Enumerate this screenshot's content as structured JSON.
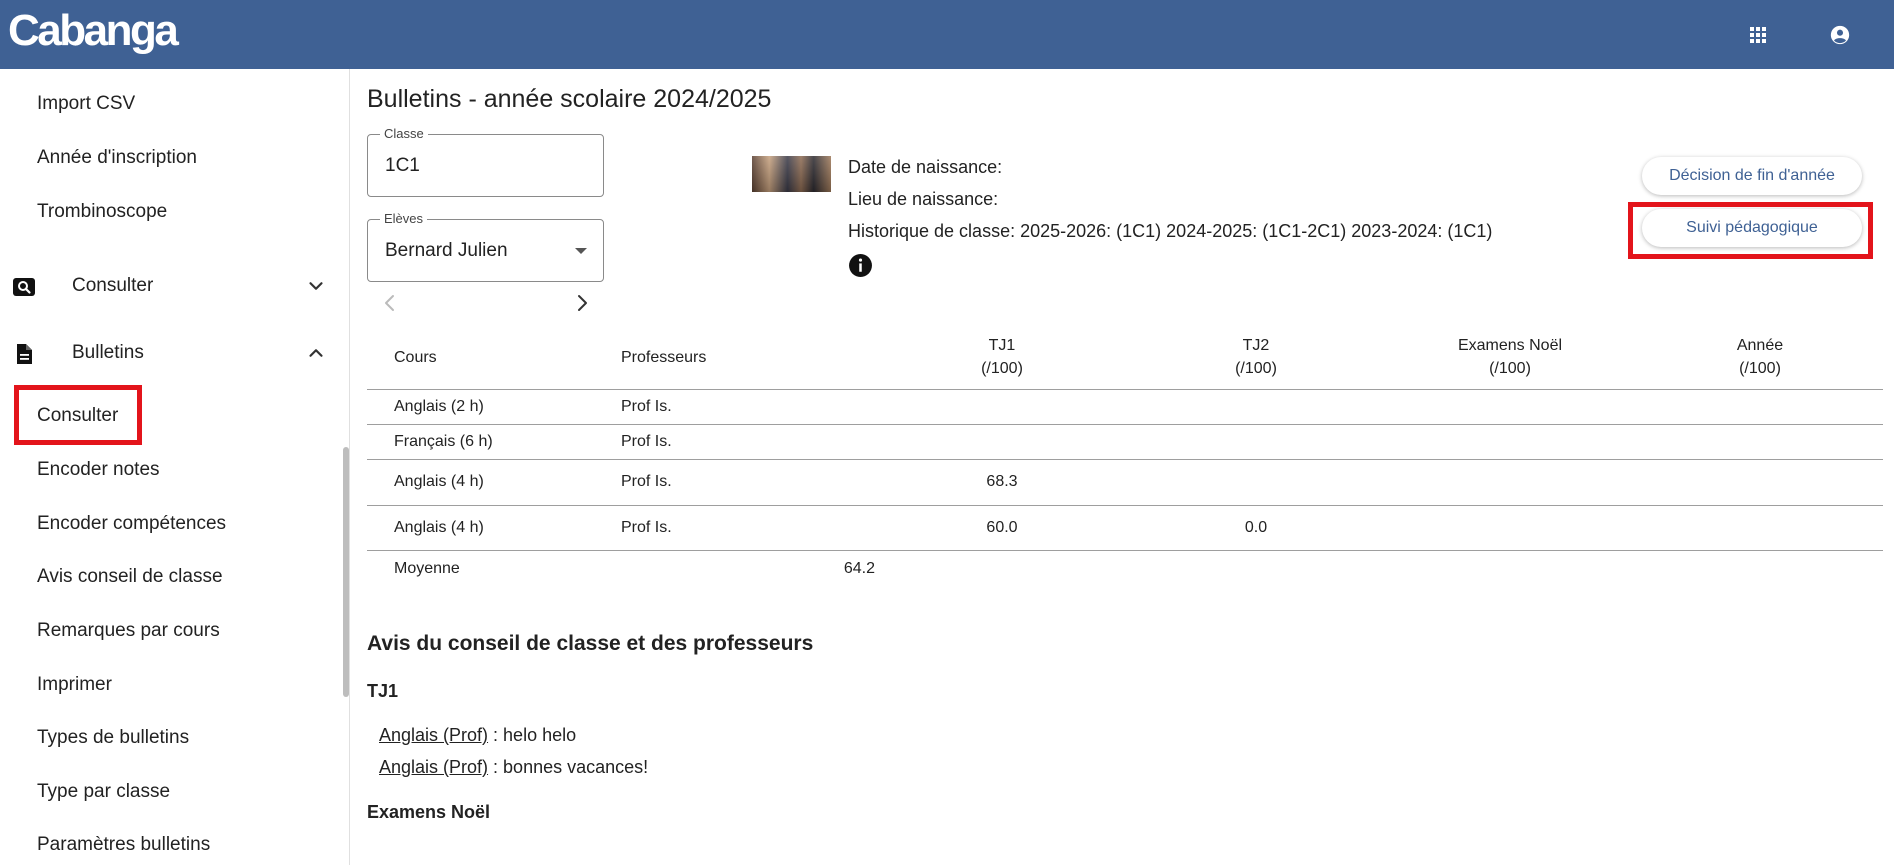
{
  "app": {
    "logo": "Cabanga",
    "apps_icon": "apps-grid-icon",
    "account_icon": "account-circle-icon",
    "header_color": "#3f6194"
  },
  "sidebar": {
    "items_top": [
      {
        "label": "Import CSV"
      },
      {
        "label": "Année d'inscription"
      },
      {
        "label": "Trombinoscope"
      }
    ],
    "groups": [
      {
        "label": "Consulter",
        "icon": "search-icon",
        "state": "collapsed"
      },
      {
        "label": "Bulletins",
        "icon": "document-icon",
        "state": "expanded"
      }
    ],
    "bulletins_items": [
      {
        "label": "Consulter",
        "selected": true
      },
      {
        "label": "Encoder notes"
      },
      {
        "label": "Encoder compétences"
      },
      {
        "label": "Avis conseil de classe"
      },
      {
        "label": "Remarques par cours"
      },
      {
        "label": "Imprimer"
      },
      {
        "label": "Types de bulletins"
      },
      {
        "label": "Type par classe"
      },
      {
        "label": "Paramètres bulletins"
      }
    ]
  },
  "main": {
    "title": "Bulletins - année scolaire 2024/2025",
    "classe": {
      "label": "Classe",
      "value": "1C1"
    },
    "eleves": {
      "label": "Elèves",
      "value": "Bernard Julien"
    },
    "student": {
      "dob": "Date de naissance:",
      "pob": "Lieu de naissance:",
      "history": "Historique de classe: 2025-2026: (1C1) 2024-2025: (1C1-2C1) 2023-2024: (1C1)"
    },
    "buttons": {
      "decision": "Décision de fin d'année",
      "suivi": "Suivi pédagogique"
    },
    "table": {
      "headers": {
        "cours": "Cours",
        "professeurs": "Professeurs",
        "tj1": "TJ1",
        "tj1_unit": "(/100)",
        "tj2": "TJ2",
        "tj2_unit": "(/100)",
        "examens": "Examens Noël",
        "examens_unit": "(/100)",
        "annee": "Année",
        "annee_unit": "(/100)"
      },
      "rows": [
        {
          "cours": "Anglais (2 h)",
          "prof": "Prof Is.",
          "tj1": "",
          "tj2": ""
        },
        {
          "cours": "Français (6 h)",
          "prof": "Prof Is.",
          "tj1": "",
          "tj2": ""
        },
        {
          "cours": "Anglais (4 h)",
          "prof": "Prof Is.",
          "tj1": "68.3",
          "tj2": ""
        },
        {
          "cours": "Anglais (4 h)",
          "prof": "Prof Is.",
          "tj1": "60.0",
          "tj2": "0.0"
        }
      ],
      "average": {
        "label": "Moyenne",
        "value": "64.2"
      }
    },
    "avis": {
      "title": "Avis du conseil de classe et des professeurs",
      "tj1_title": "TJ1",
      "remarks": [
        {
          "link": "Anglais (Prof)",
          "text": " : helo helo"
        },
        {
          "link": "Anglais (Prof)",
          "text": " : bonnes vacances!"
        }
      ],
      "examens_title": "Examens Noël"
    }
  }
}
